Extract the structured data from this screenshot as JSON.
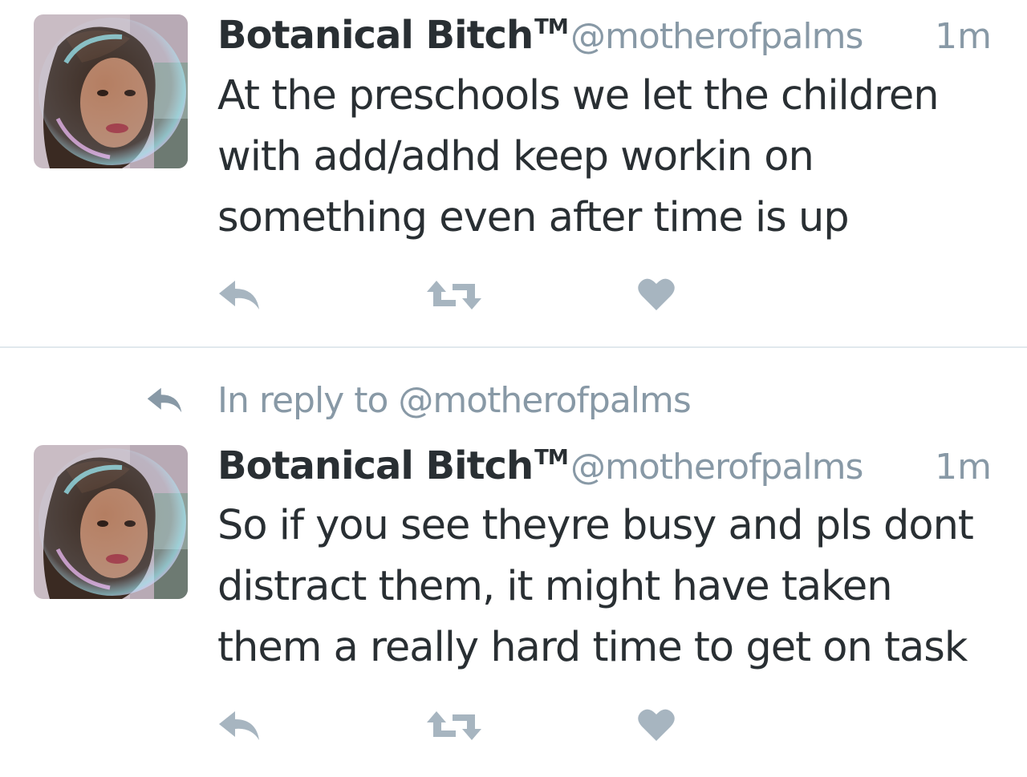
{
  "tweets": [
    {
      "display_name": "Botanical Bitch",
      "tm": "TM",
      "handle": "@motherofpalms",
      "time": "1m",
      "lines": [
        "At the preschools we let the children",
        "with add/adhd keep workin on",
        "something even after time is up"
      ],
      "icons": [
        "reply-icon",
        "retweet-icon",
        "heart-icon"
      ]
    },
    {
      "in_reply_to": "In reply to @motherofpalms",
      "display_name": "Botanical Bitch",
      "tm": "TM",
      "handle": "@motherofpalms",
      "time": "1m",
      "lines": [
        "So if you see theyre busy and pls dont",
        "distract them, it might have taken",
        "them a really hard time to get on task"
      ],
      "icons": [
        "reply-icon",
        "retweet-icon",
        "heart-icon"
      ]
    }
  ],
  "colors": {
    "text": "#292f33",
    "muted": "#8899a6",
    "icon": "#a7b5c0",
    "divider": "#e1e8ed"
  }
}
